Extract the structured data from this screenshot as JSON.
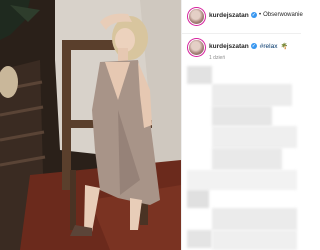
{
  "post": {
    "username": "kurdejszatan",
    "separator": "•",
    "follow_label": "Obserwowanie",
    "caption_hashtag": "#relax",
    "caption_emoji": "🌴",
    "timestamp": "1 dzień"
  },
  "photo": {
    "subject": "woman in sleeveless taupe dress sitting on wooden chair",
    "dress_color": "#a89488",
    "wall_color": "#d9d3cc",
    "floor_color": "#6b2a1c"
  }
}
